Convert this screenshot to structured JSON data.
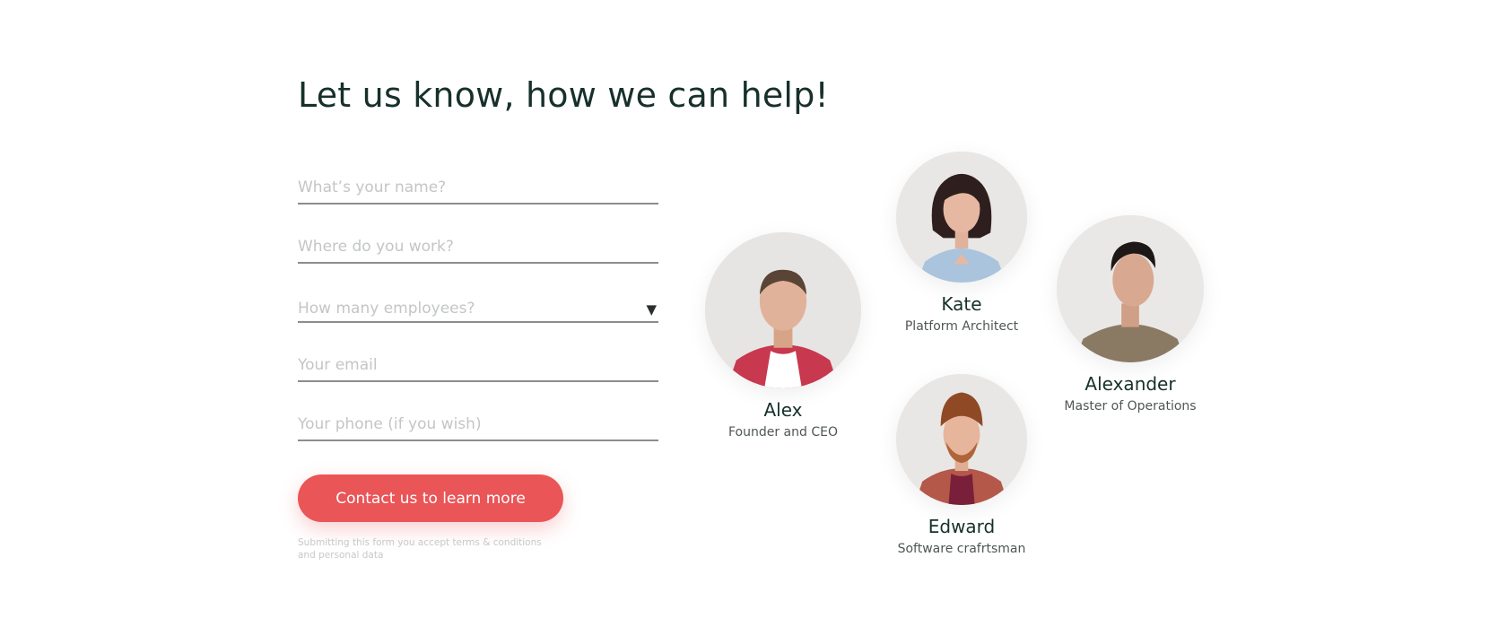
{
  "heading": "Let us know, how we can help!",
  "form": {
    "name_placeholder": "What’s your name?",
    "company_placeholder": "Where do you work?",
    "employees_placeholder": "How many employees?",
    "email_placeholder": "Your email",
    "phone_placeholder": "Your phone (if you wish)",
    "submit_label": "Contact us to learn more",
    "disclaimer": "Submitting this form you accept terms & conditions and personal data"
  },
  "team": [
    {
      "name": "Alex",
      "role": "Founder and CEO"
    },
    {
      "name": "Kate",
      "role": "Platform Architect"
    },
    {
      "name": "Alexander",
      "role": "Master of Operations"
    },
    {
      "name": "Edward",
      "role": "Software crafrtsman"
    }
  ],
  "colors": {
    "accent": "#ea5558",
    "heading": "#17302b"
  },
  "icons": {
    "select_caret": "caret-down-icon"
  }
}
